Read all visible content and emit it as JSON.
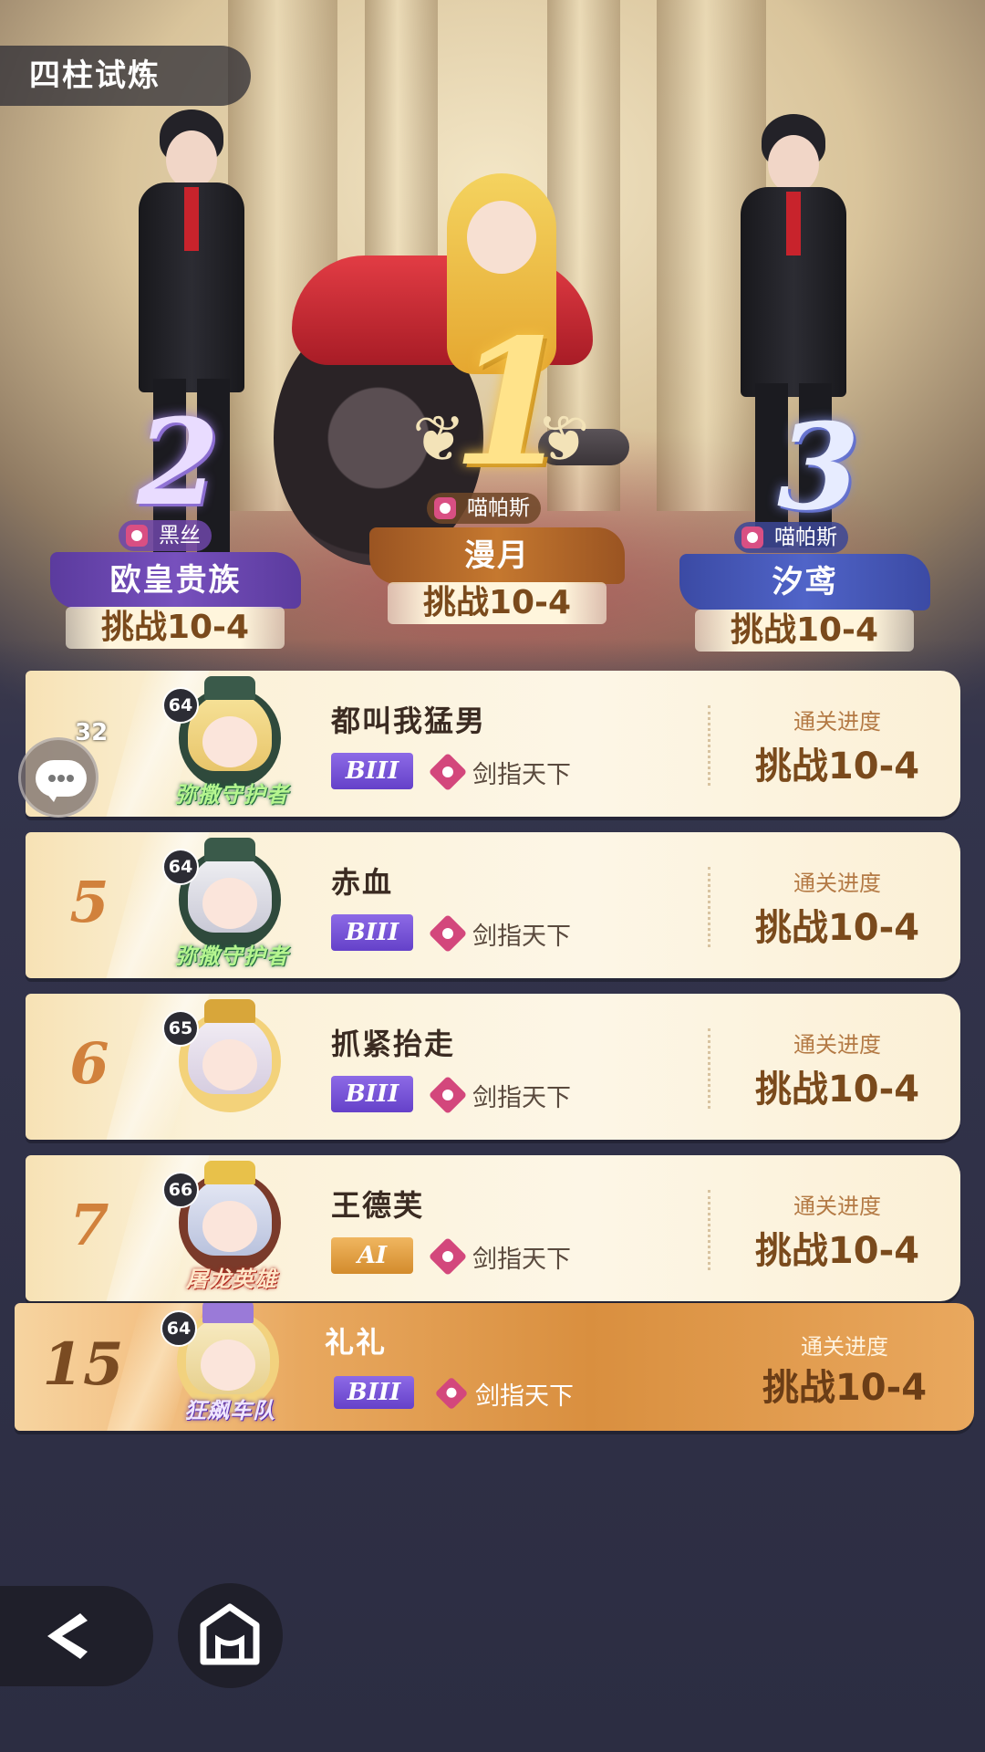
{
  "header": {
    "title": "四柱试炼"
  },
  "podium": [
    {
      "rank": "2",
      "guild": "黑丝",
      "name": "欧皇贵族",
      "progress": "挑战10-4"
    },
    {
      "rank": "1",
      "guild": "喵帕斯",
      "name": "漫月",
      "progress": "挑战10-4"
    },
    {
      "rank": "3",
      "guild": "喵帕斯",
      "name": "汐鸢",
      "progress": "挑战10-4"
    }
  ],
  "progress_label": "通关进度",
  "rows": [
    {
      "rank": "",
      "level": "64",
      "title": "弥撒守护者",
      "name": "都叫我猛男",
      "grade": "BIII",
      "guild": "剑指天下",
      "progress": "挑战10-4"
    },
    {
      "rank": "5",
      "level": "64",
      "title": "弥撒守护者",
      "name": "赤血",
      "grade": "BIII",
      "guild": "剑指天下",
      "progress": "挑战10-4"
    },
    {
      "rank": "6",
      "level": "65",
      "title": "",
      "name": "抓紧抬走",
      "grade": "BIII",
      "guild": "剑指天下",
      "progress": "挑战10-4"
    },
    {
      "rank": "7",
      "level": "66",
      "title": "屠龙英雄",
      "name": "王德芙",
      "grade": "AI",
      "guild": "剑指天下",
      "progress": "挑战10-4"
    }
  ],
  "self_row": {
    "rank": "15",
    "level": "64",
    "title": "狂飙车队",
    "name": "礼礼",
    "grade": "BIII",
    "guild": "剑指天下",
    "progress": "挑战10-4"
  },
  "chat": {
    "count": "32"
  },
  "colors": {
    "accent_gold": "#c5782f",
    "rank2_purple": "#7750bd",
    "rank3_blue": "#5064c8",
    "guild_pink": "#d3477c"
  },
  "icons": {
    "back": "back-arrow-icon",
    "home": "home-icon",
    "chat": "chat-bubble-icon",
    "guild": "guild-emblem-icon"
  }
}
